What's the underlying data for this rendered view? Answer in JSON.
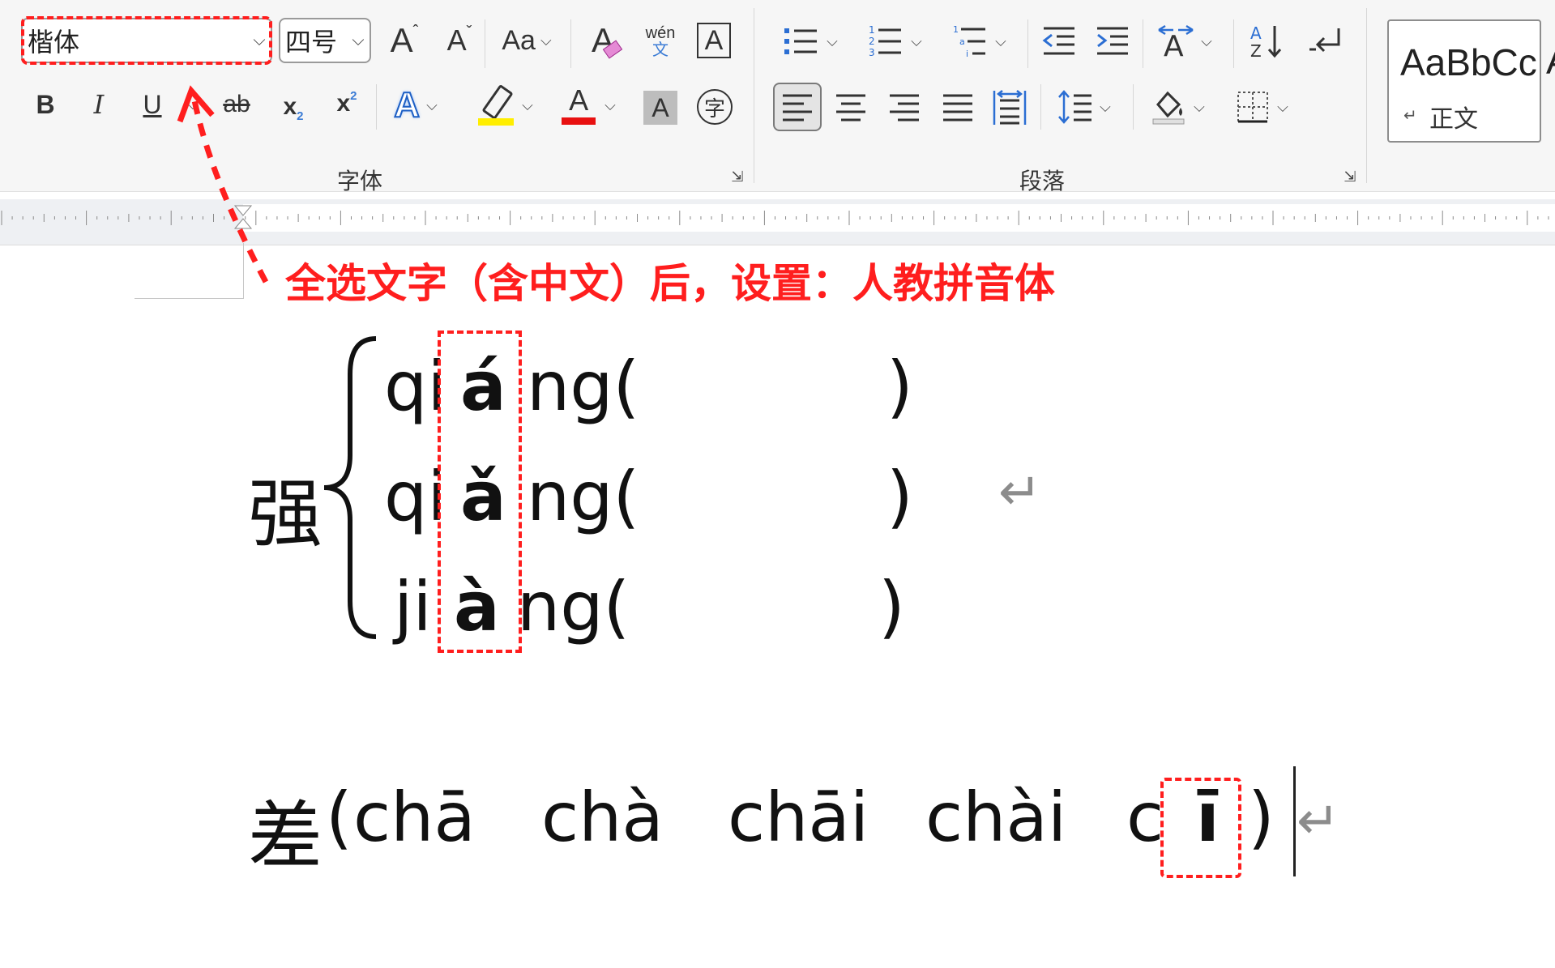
{
  "ribbon": {
    "font_group": {
      "label": "字体",
      "font_name": "楷体",
      "font_size": "四号",
      "grow_font": "A",
      "shrink_font": "A",
      "change_case": "Aa",
      "clear_format": "A",
      "phonetic_top": "wén",
      "phonetic_bottom": "文",
      "char_border": "A",
      "bold": "B",
      "italic": "I",
      "underline": "U",
      "strikethrough": "ab",
      "subscript": "x",
      "subscript_mark": "2",
      "superscript": "x",
      "superscript_mark": "2",
      "text_effects": "A",
      "font_color": "A",
      "char_shading": "A",
      "enclose_char": "字"
    },
    "paragraph_group": {
      "label": "段落"
    },
    "styles": {
      "sample": "AaBbCc",
      "name": "正文",
      "next_sample": "A"
    },
    "colors": {
      "highlight": "#ffee00",
      "font_color": "#e81010",
      "annotation": "#ff1e1e"
    }
  },
  "annotation": "全选文字（含中文）后，设置：人教拼音体",
  "document": {
    "qiang": {
      "char": "强",
      "rows": [
        {
          "pre": "qi",
          "tone": "á",
          "post": "ng(",
          "close": ")"
        },
        {
          "pre": "qi",
          "tone": "ǎ",
          "post": "ng(",
          "close": ")"
        },
        {
          "pre": "ji",
          "tone": "à",
          "post": "ng(",
          "close": ")"
        }
      ]
    },
    "cha": {
      "char": "差",
      "open": "(",
      "readings": [
        "chā",
        "chà",
        "chāi",
        "chài"
      ],
      "last_pre": "c",
      "last_tone": "ī",
      "close": ")"
    },
    "return_mark": "↵"
  }
}
